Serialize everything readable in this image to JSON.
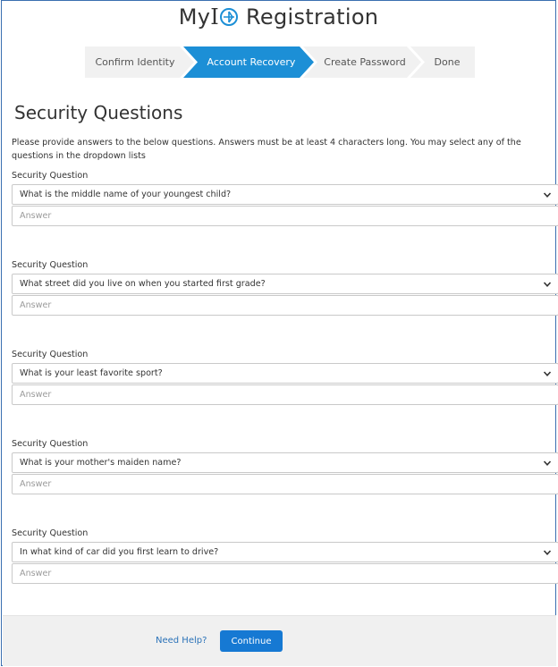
{
  "header": {
    "logo_prefix": "My",
    "logo_suffix": "Registration"
  },
  "stepper": {
    "steps": [
      {
        "label": "Confirm Identity",
        "state": "complete"
      },
      {
        "label": "Account Recovery",
        "state": "active"
      },
      {
        "label": "Create Password",
        "state": "pending"
      },
      {
        "label": "Done",
        "state": "pending"
      }
    ]
  },
  "page": {
    "title": "Security Questions",
    "intro": "Please provide answers to the below questions. Answers must be at least 4 characters long. You may select any of the questions in the dropdown lists"
  },
  "questions": [
    {
      "label": "Security Question",
      "selected": "What is the middle name of your youngest child?",
      "answer_placeholder": "Answer",
      "answer_value": ""
    },
    {
      "label": "Security Question",
      "selected": "What street did you live on when you started first grade?",
      "answer_placeholder": "Answer",
      "answer_value": ""
    },
    {
      "label": "Security Question",
      "selected": "What is your least favorite sport?",
      "answer_placeholder": "Answer",
      "answer_value": ""
    },
    {
      "label": "Security Question",
      "selected": "What is your mother's maiden name?",
      "answer_placeholder": "Answer",
      "answer_value": ""
    },
    {
      "label": "Security Question",
      "selected": "In what kind of car did you first learn to drive?",
      "answer_placeholder": "Answer",
      "answer_value": ""
    }
  ],
  "footer": {
    "help_label": "Need Help?",
    "continue_label": "Continue"
  },
  "colors": {
    "active_step": "#1c8fd6",
    "button": "#1679d3",
    "link": "#2b72b8",
    "logo_icon": "#1c8fd6"
  },
  "icons": {
    "logo": "d-logo-icon",
    "dropdown": "chevron-down-icon"
  }
}
